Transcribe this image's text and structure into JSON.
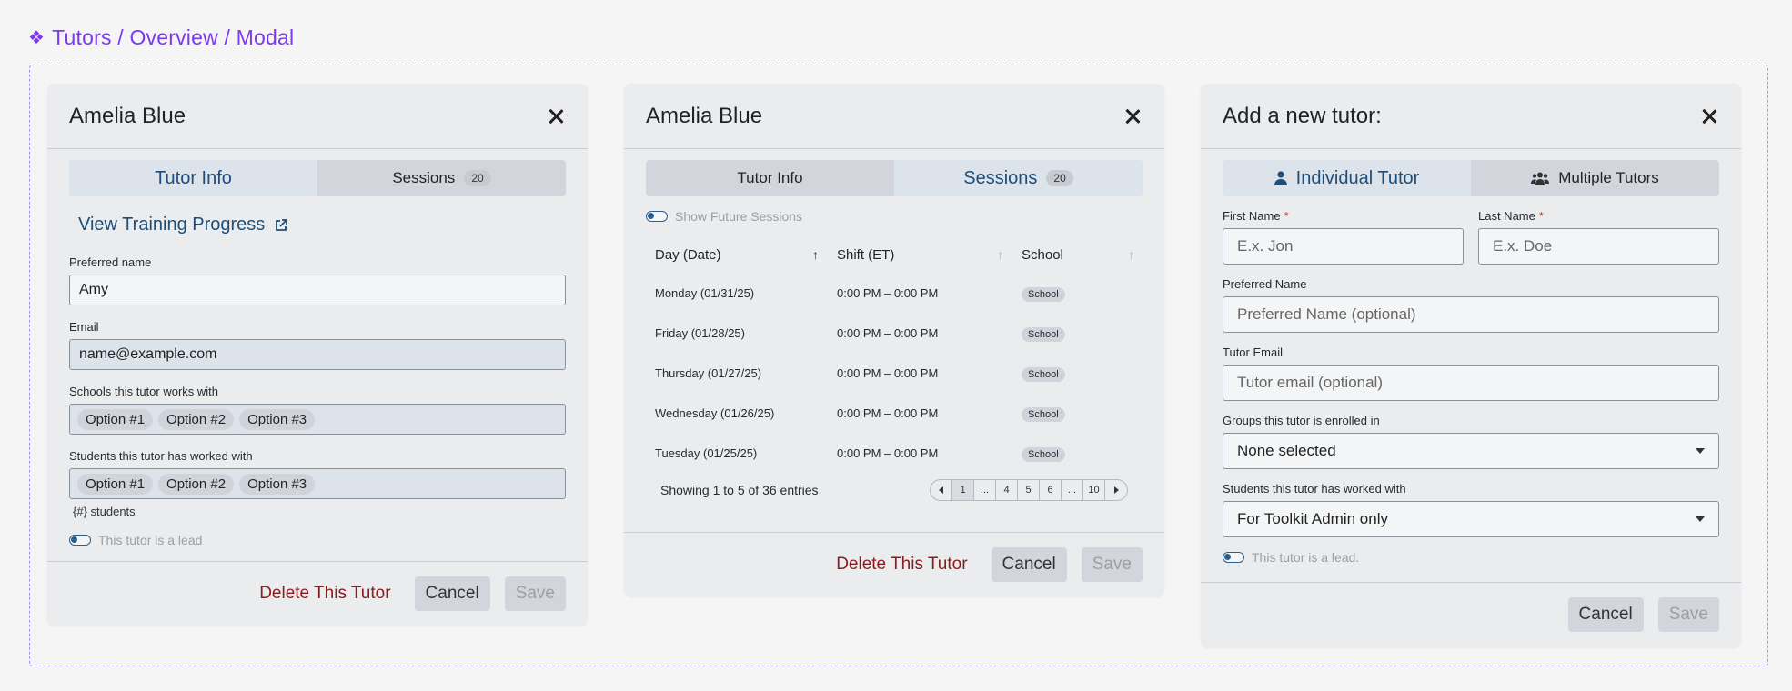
{
  "breadcrumb": {
    "text": "Tutors / Overview / Modal",
    "icon": "component-diamond-icon"
  },
  "modal1": {
    "title": "Amelia Blue",
    "tabs": [
      {
        "label": "Tutor Info",
        "active": true
      },
      {
        "label": "Sessions",
        "badge": "20"
      }
    ],
    "training_link": "View Training Progress",
    "preferred_name": {
      "label": "Preferred name",
      "value": "Amy"
    },
    "email": {
      "label": "Email",
      "value": "name@example.com"
    },
    "schools": {
      "label": "Schools this tutor works with",
      "options": [
        "Option #1",
        "Option #2",
        "Option #3"
      ]
    },
    "students": {
      "label": "Students this tutor has worked with",
      "options": [
        "Option #1",
        "Option #2",
        "Option #3"
      ],
      "hint": "{#} students"
    },
    "lead_toggle": "This tutor is a lead",
    "delete_label": "Delete This Tutor",
    "cancel_label": "Cancel",
    "save_label": "Save"
  },
  "modal2": {
    "title": "Amelia Blue",
    "tabs": [
      {
        "label": "Tutor Info"
      },
      {
        "label": "Sessions",
        "badge": "20",
        "active": true
      }
    ],
    "future_toggle": "Show Future Sessions",
    "columns": [
      "Day (Date)",
      "Shift (ET)",
      "School"
    ],
    "rows": [
      {
        "day": "Monday (01/31/25)",
        "shift": "0:00 PM – 0:00 PM",
        "school": "School"
      },
      {
        "day": "Friday (01/28/25)",
        "shift": "0:00 PM – 0:00 PM",
        "school": "School"
      },
      {
        "day": "Thursday (01/27/25)",
        "shift": "0:00 PM – 0:00 PM",
        "school": "School"
      },
      {
        "day": "Wednesday (01/26/25)",
        "shift": "0:00 PM – 0:00 PM",
        "school": "School"
      },
      {
        "day": "Tuesday (01/25/25)",
        "shift": "0:00 PM – 0:00 PM",
        "school": "School"
      }
    ],
    "entries_text": "Showing 1 to 5 of 36 entries",
    "pages": [
      "1",
      "...",
      "4",
      "5",
      "6",
      "...",
      "10"
    ],
    "delete_label": "Delete This Tutor",
    "cancel_label": "Cancel",
    "save_label": "Save"
  },
  "modal3": {
    "title": "Add a new tutor:",
    "tabs": [
      {
        "label": "Individual Tutor",
        "active": true
      },
      {
        "label": "Multiple Tutors"
      }
    ],
    "first_name": {
      "label": "First Name",
      "placeholder": "E.x. Jon"
    },
    "last_name": {
      "label": "Last Name",
      "placeholder": "E.x. Doe"
    },
    "preferred_name": {
      "label": "Preferred Name",
      "placeholder": "Preferred Name (optional)"
    },
    "tutor_email": {
      "label": "Tutor Email",
      "placeholder": "Tutor email (optional)"
    },
    "groups": {
      "label": "Groups this tutor is enrolled in",
      "value": "None selected"
    },
    "students": {
      "label": "Students this tutor has worked with",
      "value": "For Toolkit Admin only"
    },
    "lead_toggle": "This tutor is a lead.",
    "cancel_label": "Cancel",
    "save_label": "Save"
  },
  "colors": {
    "accent": "#7c3aed",
    "link": "#1e4e79",
    "danger": "#8a1c1c"
  }
}
